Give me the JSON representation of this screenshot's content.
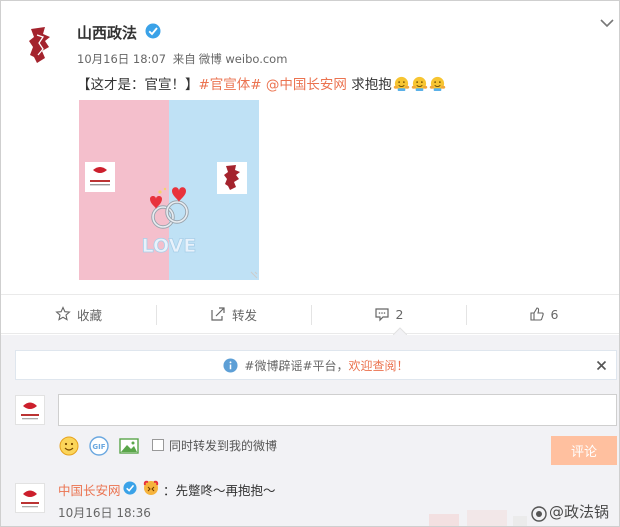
{
  "post": {
    "author": "山西政法",
    "timestamp": "10月16日 18:07",
    "source_prefix": "来自",
    "source": "微博 weibo.com",
    "text_prefix": "【这才是：官宣！】",
    "hashtag": "#官宣体#",
    "mention": "@中国长安网",
    "text_suffix": "求抱抱",
    "image_text": "LOVE"
  },
  "actions": {
    "favorite_label": "收藏",
    "repost_label": "转发",
    "comment_count": "2",
    "like_count": "6"
  },
  "notice": {
    "prefix": "#微博辟谣#平台，",
    "highlight": "欢迎查阅！"
  },
  "composer": {
    "repost_checkbox_label": "同时转发到我的微博",
    "submit_label": "评论",
    "gif_label": "GIF"
  },
  "comment": {
    "author": "中国长安网",
    "text": "：先蹩咚～再抱抱～",
    "timestamp": "10月16日 18:36"
  },
  "watermark": "@政法锅",
  "colors": {
    "accent": "#eb7350",
    "verified_blue": "#3aa2e8",
    "pink_half": "#f4bfcc",
    "blue_half": "#bfe1f5",
    "submit_disabled": "#ffc09f"
  }
}
